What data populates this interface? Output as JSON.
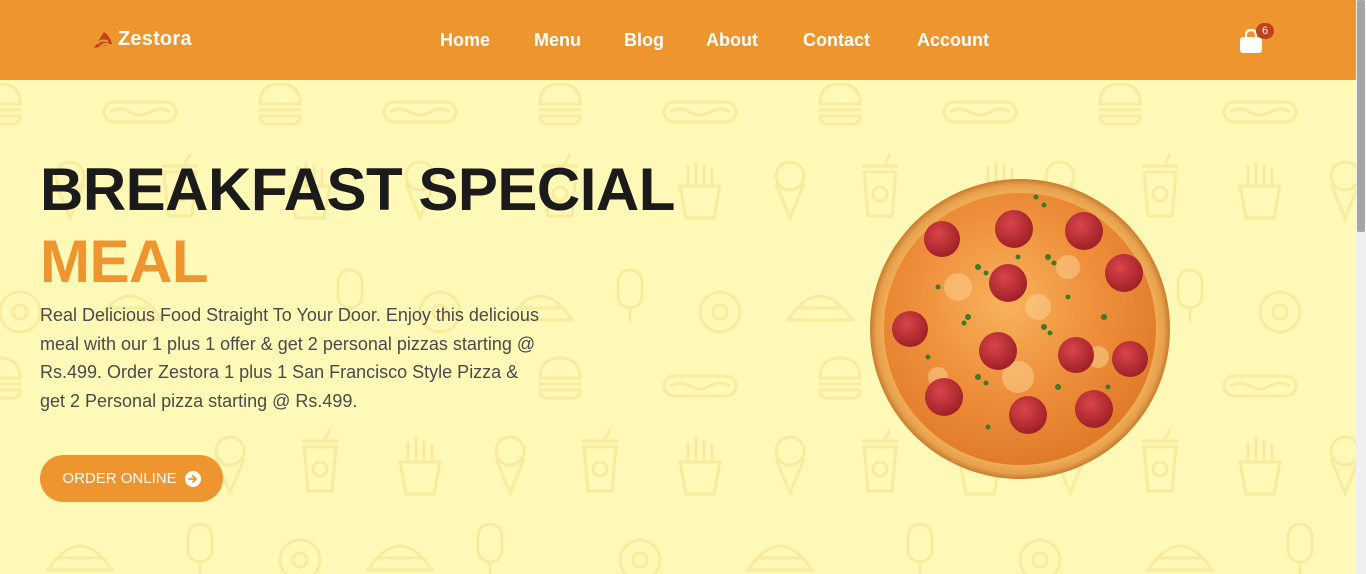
{
  "header": {
    "brand_name": "Zestora",
    "brand_icon": "pizza-slice-icon",
    "nav": [
      "Home",
      "Menu",
      "Blog",
      "About",
      "Contact",
      "Account"
    ],
    "cart_icon": "shopping-bag-icon",
    "cart_count": "6"
  },
  "hero": {
    "title_line1": "BREAKFAST SPECIAL",
    "title_line2": "MEAL",
    "description": "Real Delicious Food Straight To Your Door. Enjoy this delicious meal with our 1 plus 1 offer & get 2 personal pizzas starting @ Rs.499. Order Zestora 1 plus 1 San Francisco Style Pizza & get 2 Personal pizza starting @ Rs.499.",
    "cta_label": "ORDER ONLINE",
    "cta_icon": "arrow-right-circle-icon",
    "image": "pepperoni-pizza"
  },
  "colors": {
    "accent": "#ee9530",
    "background": "#fff9b8",
    "title": "#1b1b1b",
    "badge": "#c0431b"
  }
}
